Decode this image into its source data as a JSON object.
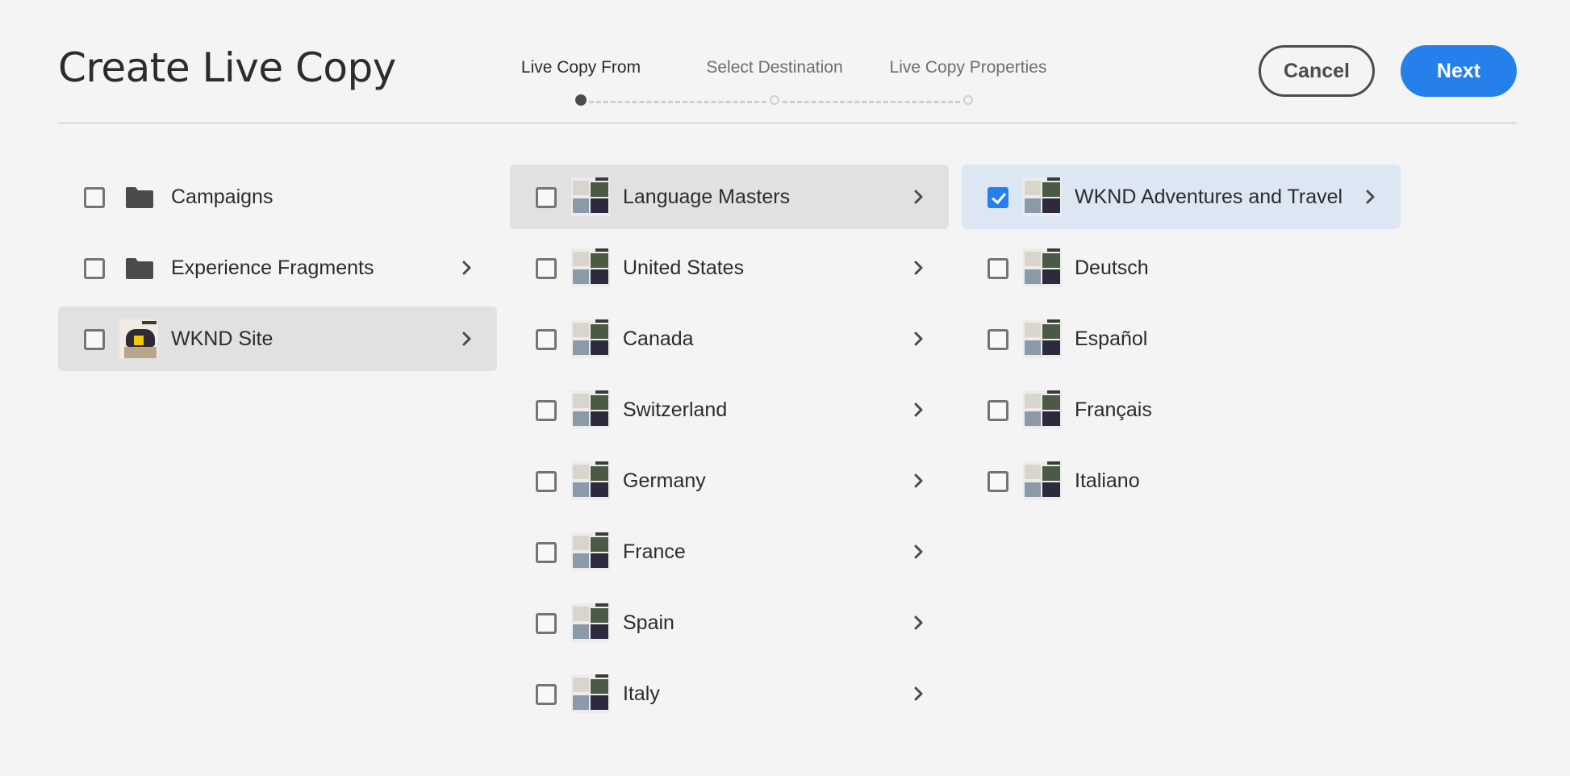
{
  "header": {
    "title": "Create Live Copy",
    "cancel_label": "Cancel",
    "next_label": "Next",
    "accent_color": "#2680eb"
  },
  "wizard": {
    "steps": [
      {
        "label": "Live Copy From",
        "active": true
      },
      {
        "label": "Select Destination",
        "active": false
      },
      {
        "label": "Live Copy Properties",
        "active": false
      }
    ]
  },
  "columns": [
    {
      "items": [
        {
          "label": "Campaigns",
          "icon": "folder-icon",
          "checked": false,
          "has_children": false,
          "state": ""
        },
        {
          "label": "Experience Fragments",
          "icon": "folder-icon",
          "checked": false,
          "has_children": true,
          "state": ""
        },
        {
          "label": "WKND Site",
          "icon": "site-thumbnail",
          "checked": false,
          "has_children": true,
          "state": "highlight"
        }
      ]
    },
    {
      "items": [
        {
          "label": "Language Masters",
          "icon": "page-thumbnail",
          "checked": false,
          "has_children": true,
          "state": "highlight"
        },
        {
          "label": "United States",
          "icon": "page-thumbnail",
          "checked": false,
          "has_children": true,
          "state": ""
        },
        {
          "label": "Canada",
          "icon": "page-thumbnail",
          "checked": false,
          "has_children": true,
          "state": ""
        },
        {
          "label": "Switzerland",
          "icon": "page-thumbnail",
          "checked": false,
          "has_children": true,
          "state": ""
        },
        {
          "label": "Germany",
          "icon": "page-thumbnail",
          "checked": false,
          "has_children": true,
          "state": ""
        },
        {
          "label": "France",
          "icon": "page-thumbnail",
          "checked": false,
          "has_children": true,
          "state": ""
        },
        {
          "label": "Spain",
          "icon": "page-thumbnail",
          "checked": false,
          "has_children": true,
          "state": ""
        },
        {
          "label": "Italy",
          "icon": "page-thumbnail",
          "checked": false,
          "has_children": true,
          "state": ""
        }
      ]
    },
    {
      "items": [
        {
          "label": "WKND Adventures and Travel",
          "icon": "page-thumbnail",
          "checked": true,
          "has_children": true,
          "state": "selected"
        },
        {
          "label": "Deutsch",
          "icon": "page-thumbnail",
          "checked": false,
          "has_children": false,
          "state": ""
        },
        {
          "label": "Español",
          "icon": "page-thumbnail",
          "checked": false,
          "has_children": false,
          "state": ""
        },
        {
          "label": "Français",
          "icon": "page-thumbnail",
          "checked": false,
          "has_children": false,
          "state": ""
        },
        {
          "label": "Italiano",
          "icon": "page-thumbnail",
          "checked": false,
          "has_children": false,
          "state": ""
        }
      ]
    }
  ]
}
